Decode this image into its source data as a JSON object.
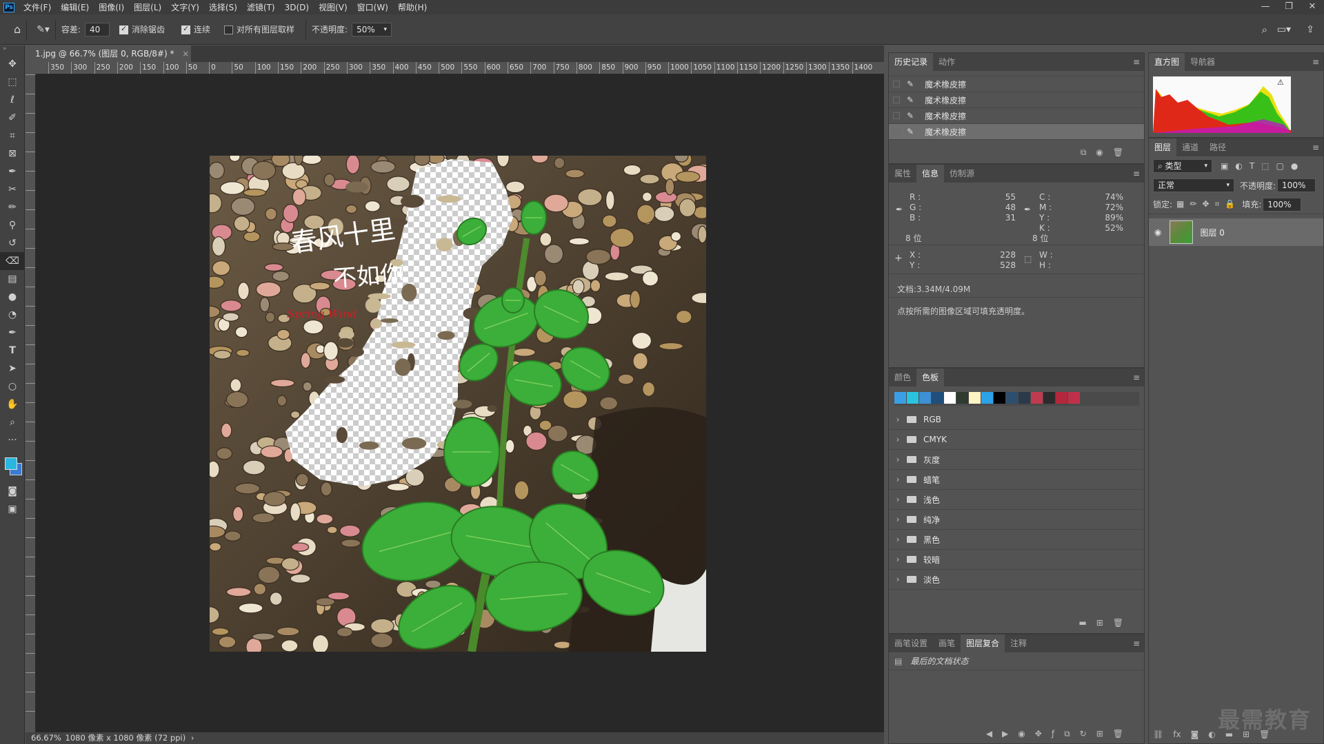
{
  "app": {
    "logo": "Ps"
  },
  "menu": [
    "文件(F)",
    "编辑(E)",
    "图像(I)",
    "图层(L)",
    "文字(Y)",
    "选择(S)",
    "滤镜(T)",
    "3D(D)",
    "视图(V)",
    "窗口(W)",
    "帮助(H)"
  ],
  "window_controls": [
    "—",
    "❐",
    "✕"
  ],
  "options": {
    "tolerance_label": "容差:",
    "tolerance_value": "40",
    "antialias_label": "消除锯齿",
    "antialias_checked": true,
    "contiguous_label": "连续",
    "contiguous_checked": true,
    "sample_all_label": "对所有图层取样",
    "sample_all_checked": false,
    "opacity_label": "不透明度:",
    "opacity_value": "50%"
  },
  "document": {
    "tab_title": "1.jpg @ 66.7% (图层 0, RGB/8#) *",
    "zoom": "66.67%",
    "status": "1080 像素 x 1080 像素 (72 ppi)",
    "ruler_labels": [
      "350",
      "300",
      "250",
      "200",
      "150",
      "100",
      "50",
      "0",
      "50",
      "100",
      "150",
      "200",
      "250",
      "300",
      "350",
      "400",
      "450",
      "500",
      "550",
      "600",
      "650",
      "700",
      "750",
      "800",
      "850",
      "900",
      "950",
      "1000",
      "1050",
      "1100",
      "1150",
      "1200",
      "1250",
      "1300",
      "1350",
      "1400"
    ],
    "canvas_text": {
      "line1": "春风十里",
      "line2": "不如你",
      "english": "Spring Wind"
    }
  },
  "history": {
    "tabs": [
      "历史记录",
      "动作"
    ],
    "items": [
      "魔术橡皮擦",
      "魔术橡皮擦",
      "魔术橡皮擦",
      "魔术橡皮擦"
    ]
  },
  "info": {
    "tabs": [
      "属性",
      "信息",
      "仿制源"
    ],
    "rgb": {
      "R": "55",
      "G": "48",
      "B": "31"
    },
    "cmyk": {
      "C": "74%",
      "M": "72%",
      "Y": "89%",
      "K": "52%"
    },
    "bits_left": "8 位",
    "bits_right": "8 位",
    "x": "228",
    "y": "528",
    "w": "",
    "h": "",
    "doc_size": "文档:3.34M/4.09M",
    "hint": "点按所需的图像区域可填充透明度。"
  },
  "swatches": {
    "tabs": [
      "颜色",
      "色板"
    ],
    "colors": [
      "#3aa0e6",
      "#29c4e0",
      "#3d8fd6",
      "#1f4f7a",
      "#ffffff",
      "#2e3b2e",
      "#fff3c4",
      "#2aa3e8",
      "#000000",
      "#2e4e6e",
      "#2a3a4a",
      "#c23a50",
      "#2b2b2b",
      "#b3283c",
      "#c0304a"
    ],
    "groups": [
      "RGB",
      "CMYK",
      "灰度",
      "蜡笔",
      "浅色",
      "纯净",
      "黑色",
      "较暗",
      "淡色"
    ]
  },
  "bottom_panel": {
    "tabs": [
      "画笔设置",
      "画笔",
      "图层复合",
      "注释"
    ],
    "item": "最后的文档状态"
  },
  "histogram": {
    "tabs": [
      "直方图",
      "导航器"
    ]
  },
  "layers": {
    "tabs": [
      "图层",
      "通道",
      "路径"
    ],
    "filter": "类型",
    "blend_mode": "正常",
    "opacity_label": "不透明度:",
    "opacity_value": "100%",
    "lock_label": "锁定:",
    "fill_label": "填充:",
    "fill_value": "100%",
    "layer_name": "图层 0"
  },
  "watermark": "最需教育"
}
